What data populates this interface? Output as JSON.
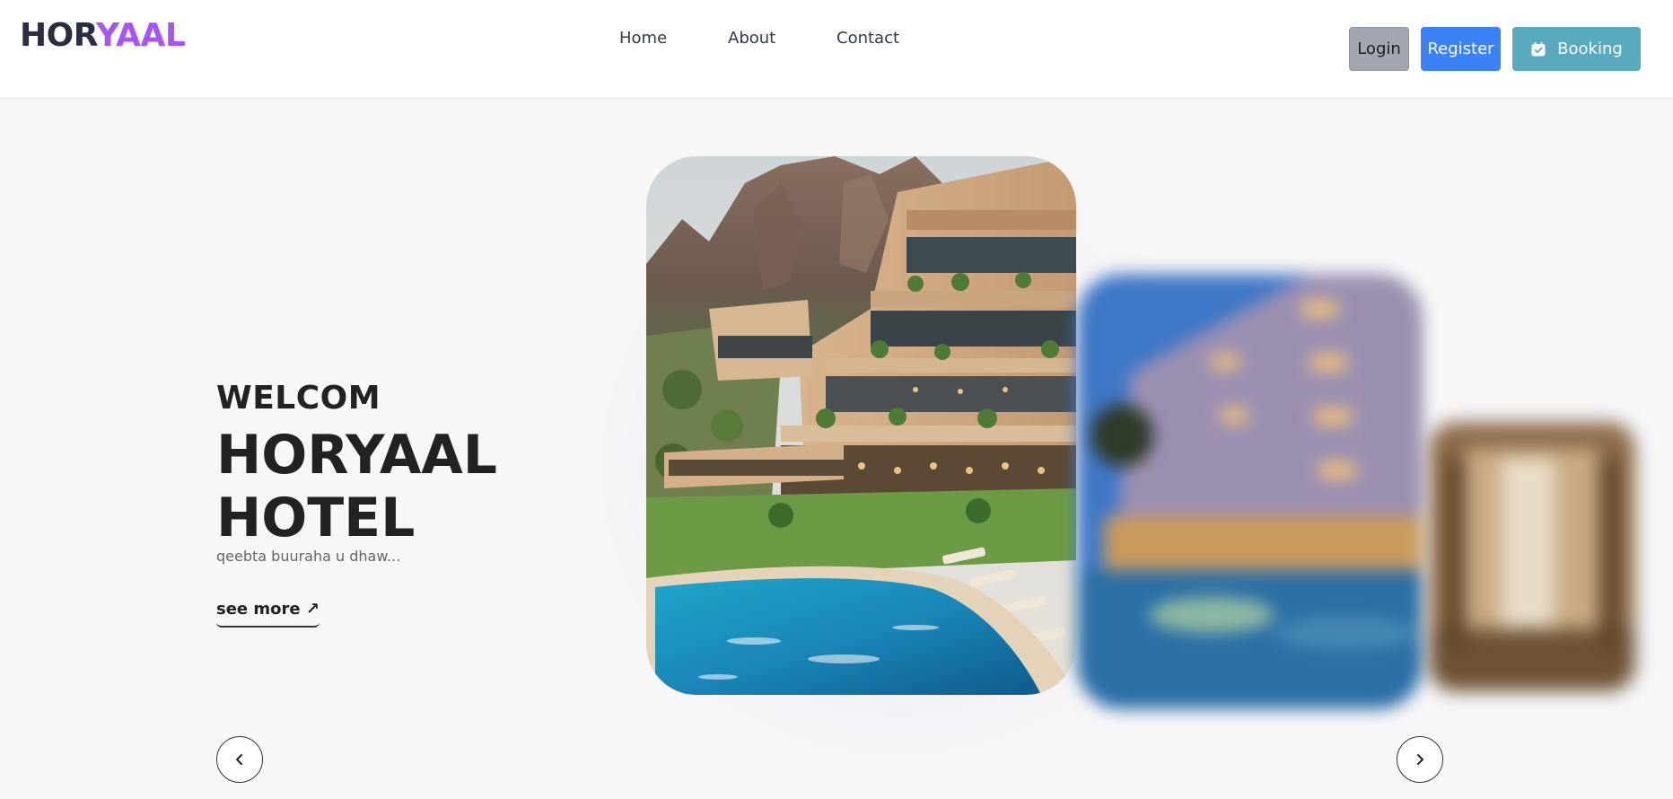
{
  "brand": {
    "part1": "HOR",
    "part2": "YAAL",
    "color_dark": "#2b2d42",
    "color_accent": "#a855f7"
  },
  "nav": {
    "items": [
      {
        "label": "Home"
      },
      {
        "label": "About"
      },
      {
        "label": "Contact"
      }
    ]
  },
  "header_buttons": {
    "login": {
      "label": "Login",
      "color": "#a3a6b1"
    },
    "register": {
      "label": "Register",
      "color": "#3b82f6"
    },
    "booking": {
      "label": "Booking",
      "icon": "calendar-check-icon",
      "color": "#5aaabf"
    }
  },
  "hero": {
    "welcome": "WELCOM",
    "title": "HORYAAL HOTEL",
    "subtitle": "qeebta buuraha u dhaw...",
    "see_more": "see more ↗"
  },
  "carousel": {
    "slides": [
      {
        "name": "mountain-resort-pool-image",
        "state": "active"
      },
      {
        "name": "hotel-building-pool-image",
        "state": "blurred"
      },
      {
        "name": "hotel-interior-image",
        "state": "blurred"
      }
    ],
    "prev_icon": "chevron-left-icon",
    "next_icon": "chevron-right-icon"
  }
}
